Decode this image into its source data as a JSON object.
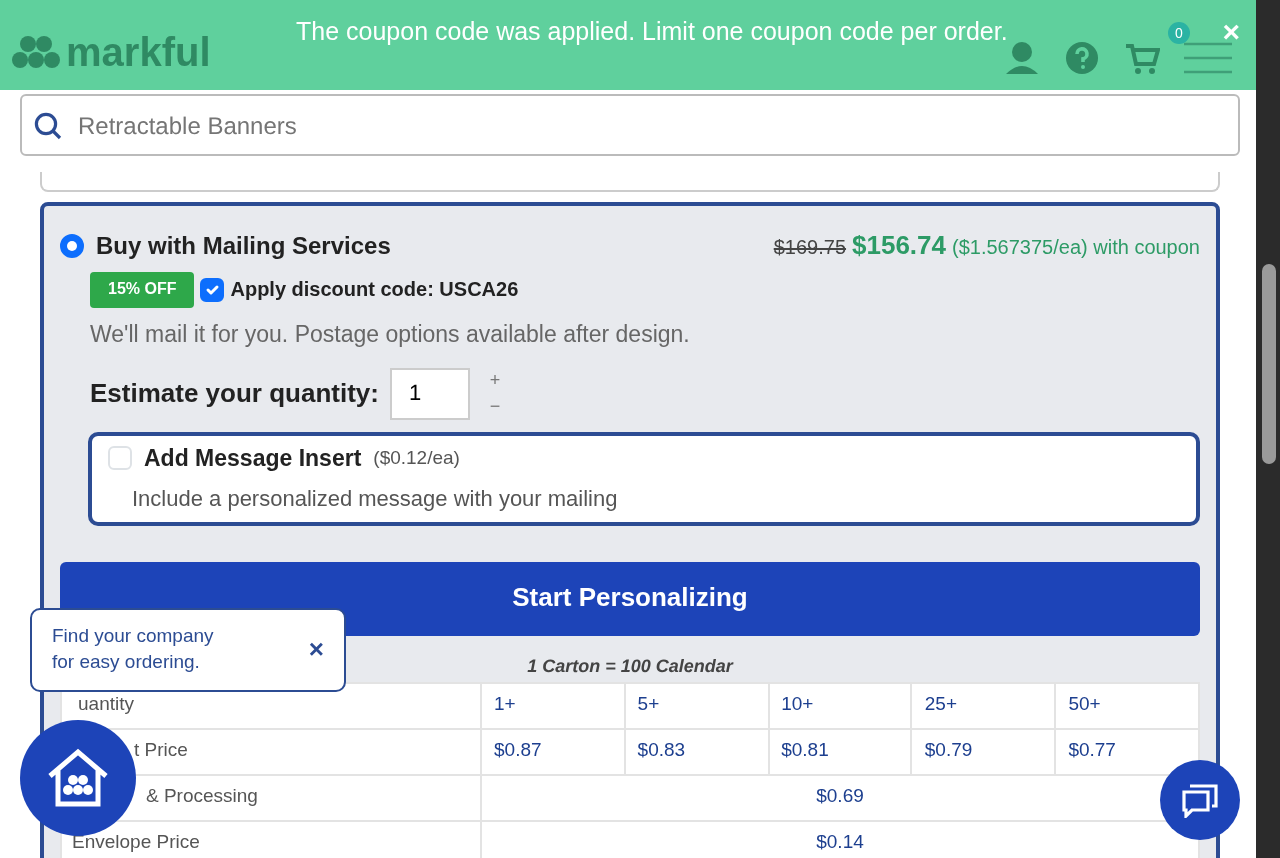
{
  "header": {
    "logo": "markful",
    "notice": "The coupon code was applied. Limit one coupon code per order.",
    "cart_count": "0"
  },
  "search": {
    "placeholder": "Retractable Banners"
  },
  "option": {
    "selected": true,
    "title": "Buy with Mailing Services",
    "old_price": "$169.75",
    "price": "$156.74",
    "unit_price": "($1.567375/ea) with coupon",
    "badge": "15% OFF",
    "discount_checked": true,
    "discount_label": "Apply discount code: USCA26",
    "description": "We'll mail it for you. Postage options available after design.",
    "quantity_label": "Estimate your quantity:",
    "quantity": "1",
    "plus": "+",
    "minus": "−"
  },
  "insert": {
    "checked": false,
    "title": "Add Message Insert",
    "price": "($0.12/ea)",
    "description": "Include a personalized message with your mailing"
  },
  "start_button": "Start Personalizing",
  "table": {
    "caption": "1 Carton = 100 Calendar",
    "rows": [
      {
        "label": "uantity",
        "cells": [
          "1+",
          "5+",
          "10+",
          "25+",
          "50+"
        ]
      },
      {
        "label": "t Price",
        "cells": [
          "$0.87",
          "$0.83",
          "$0.81",
          "$0.79",
          "$0.77"
        ]
      },
      {
        "label": "& Processing",
        "cells": [
          {
            "text": "$0.69",
            "colspan": 5
          }
        ]
      },
      {
        "label": "Envelope Price",
        "cells": [
          {
            "text": "$0.14",
            "colspan": 5
          }
        ]
      }
    ]
  },
  "popup": {
    "text": "Find your company for easy ordering.",
    "close": "×"
  },
  "close_notice": "×"
}
